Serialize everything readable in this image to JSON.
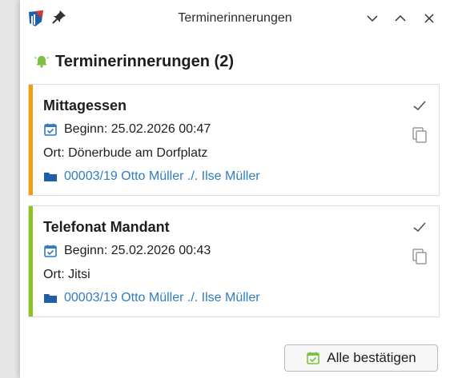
{
  "window": {
    "title": "Terminerinnerungen"
  },
  "header": {
    "title": "Terminerinnerungen (2)"
  },
  "reminders": [
    {
      "subject": "Mittagessen",
      "begin": "Beginn: 25.02.2026 00:47",
      "location": "Ort: Dönerbude am Dorfplatz",
      "case": "00003/19 Otto Müller ./. Ilse Müller",
      "stripe_color": "#f39c12"
    },
    {
      "subject": "Telefonat Mandant",
      "begin": "Beginn: 25.02.2026 00:43",
      "location": "Ort: Jitsi",
      "case": "00003/19 Otto Müller ./. Ilse Müller",
      "stripe_color": "#8dc21f"
    }
  ],
  "footer": {
    "confirm_all_label": "Alle bestätigen"
  },
  "colors": {
    "link": "#2f7cc0",
    "bell": "#7ac142",
    "calendar_icon": "#2f7cc0",
    "confirm_icon": "#7ac142"
  }
}
